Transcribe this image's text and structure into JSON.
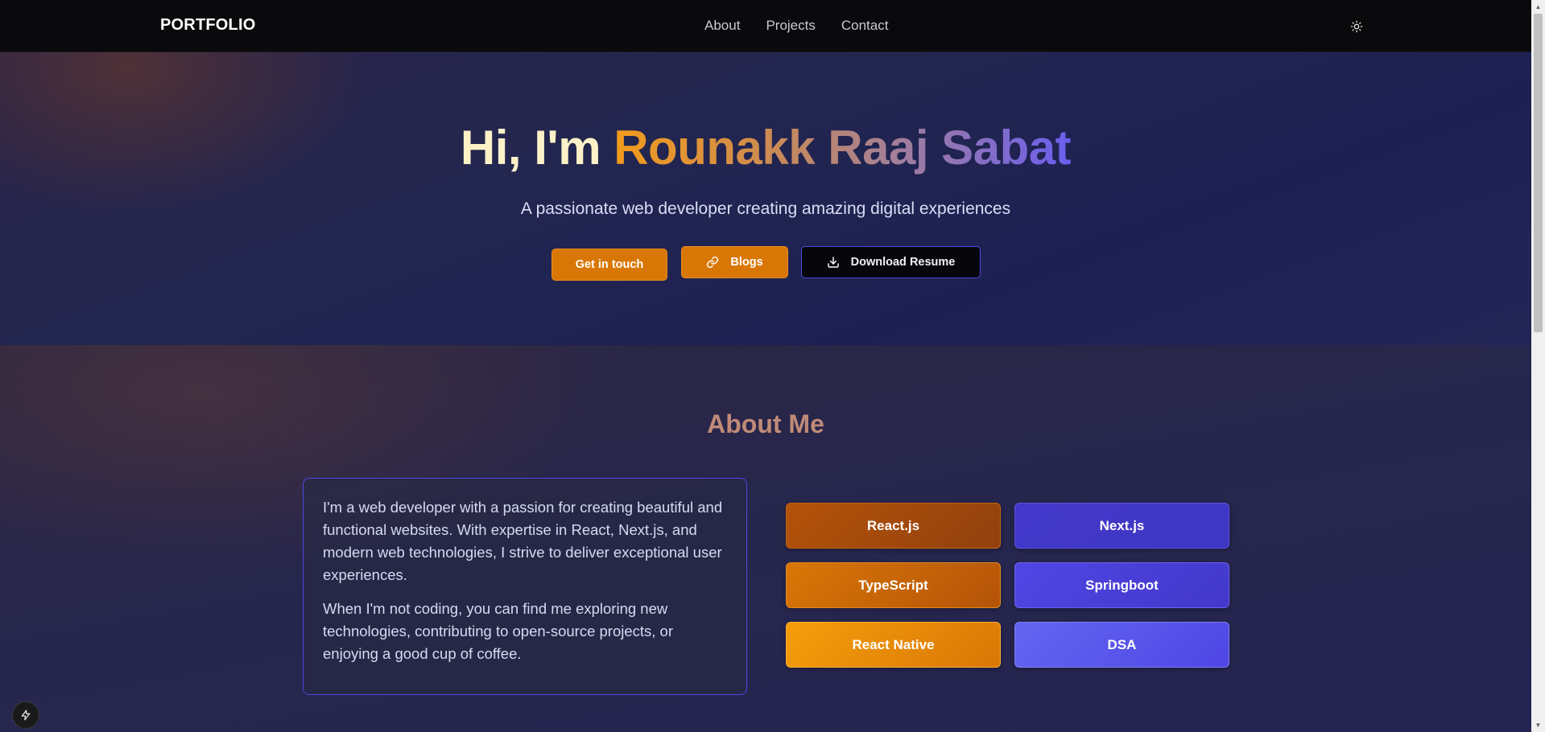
{
  "nav": {
    "logo": "PORTFOLIO",
    "links": [
      "About",
      "Projects",
      "Contact"
    ],
    "theme_icon": "sun-icon"
  },
  "hero": {
    "greeting": "Hi, I'm ",
    "name": "Rounakk Raaj Sabat",
    "subtitle": "A passionate web developer creating amazing digital experiences",
    "buttons": {
      "contact": "Get in touch",
      "blogs": "Blogs",
      "resume": "Download Resume"
    }
  },
  "about": {
    "title": "About Me",
    "paragraphs": [
      "I'm a web developer with a passion for creating beautiful and functional websites. With expertise in React, Next.js, and modern web technologies, I strive to deliver exceptional user experiences.",
      "When I'm not coding, you can find me exploring new technologies, contributing to open-source projects, or enjoying a good cup of coffee."
    ],
    "skills": [
      "React.js",
      "Next.js",
      "TypeScript",
      "Springboot",
      "React Native",
      "DSA"
    ]
  },
  "colors": {
    "accent_orange": "#d97706",
    "accent_indigo": "#4f46e5",
    "nav_bg": "#0a0a0c"
  }
}
